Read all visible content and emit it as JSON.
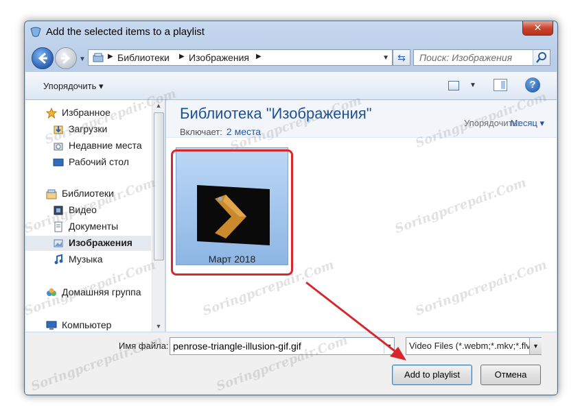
{
  "window": {
    "title": "Add the selected items to a playlist",
    "close_label": "✕"
  },
  "nav": {
    "breadcrumbs": [
      "Библиотеки",
      "Изображения"
    ],
    "search_placeholder": "Поиск: Изображения"
  },
  "toolbar": {
    "organize_label": "Упорядочить ▾",
    "help_label": "?"
  },
  "sidebar": {
    "items": [
      {
        "label": "Избранное",
        "icon": "star-icon"
      },
      {
        "label": "Загрузки",
        "icon": "downloads-icon"
      },
      {
        "label": "Недавние места",
        "icon": "recent-places-icon"
      },
      {
        "label": "Рабочий стол",
        "icon": "desktop-icon"
      },
      {
        "label": "Библиотеки",
        "icon": "libraries-icon"
      },
      {
        "label": "Видео",
        "icon": "video-icon"
      },
      {
        "label": "Документы",
        "icon": "documents-icon"
      },
      {
        "label": "Изображения",
        "icon": "images-icon",
        "selected": true
      },
      {
        "label": "Музыка",
        "icon": "music-icon"
      },
      {
        "label": "Домашняя группа",
        "icon": "homegroup-icon"
      },
      {
        "label": "Компьютер",
        "icon": "computer-icon"
      }
    ]
  },
  "library": {
    "title": "Библиотека \"Изображения\"",
    "includes_label": "Включает:",
    "includes_link": "2 места",
    "arrange_label": "Упорядочить:",
    "arrange_value": "Месяц ▾"
  },
  "items": [
    {
      "name": "Март 2018"
    }
  ],
  "footer": {
    "filename_label": "Имя файла:",
    "filename_value": "penrose-triangle-illusion-gif.gif",
    "filetype_value": "Video Files (*.webm;*.mkv;*.flv",
    "ok_label": "Add to playlist",
    "cancel_label": "Отмена"
  },
  "watermark": "Soringpcrepair.Com",
  "colors": {
    "accent": "#1e4f93",
    "highlight": "#d7272d",
    "link": "#1f55a8"
  }
}
